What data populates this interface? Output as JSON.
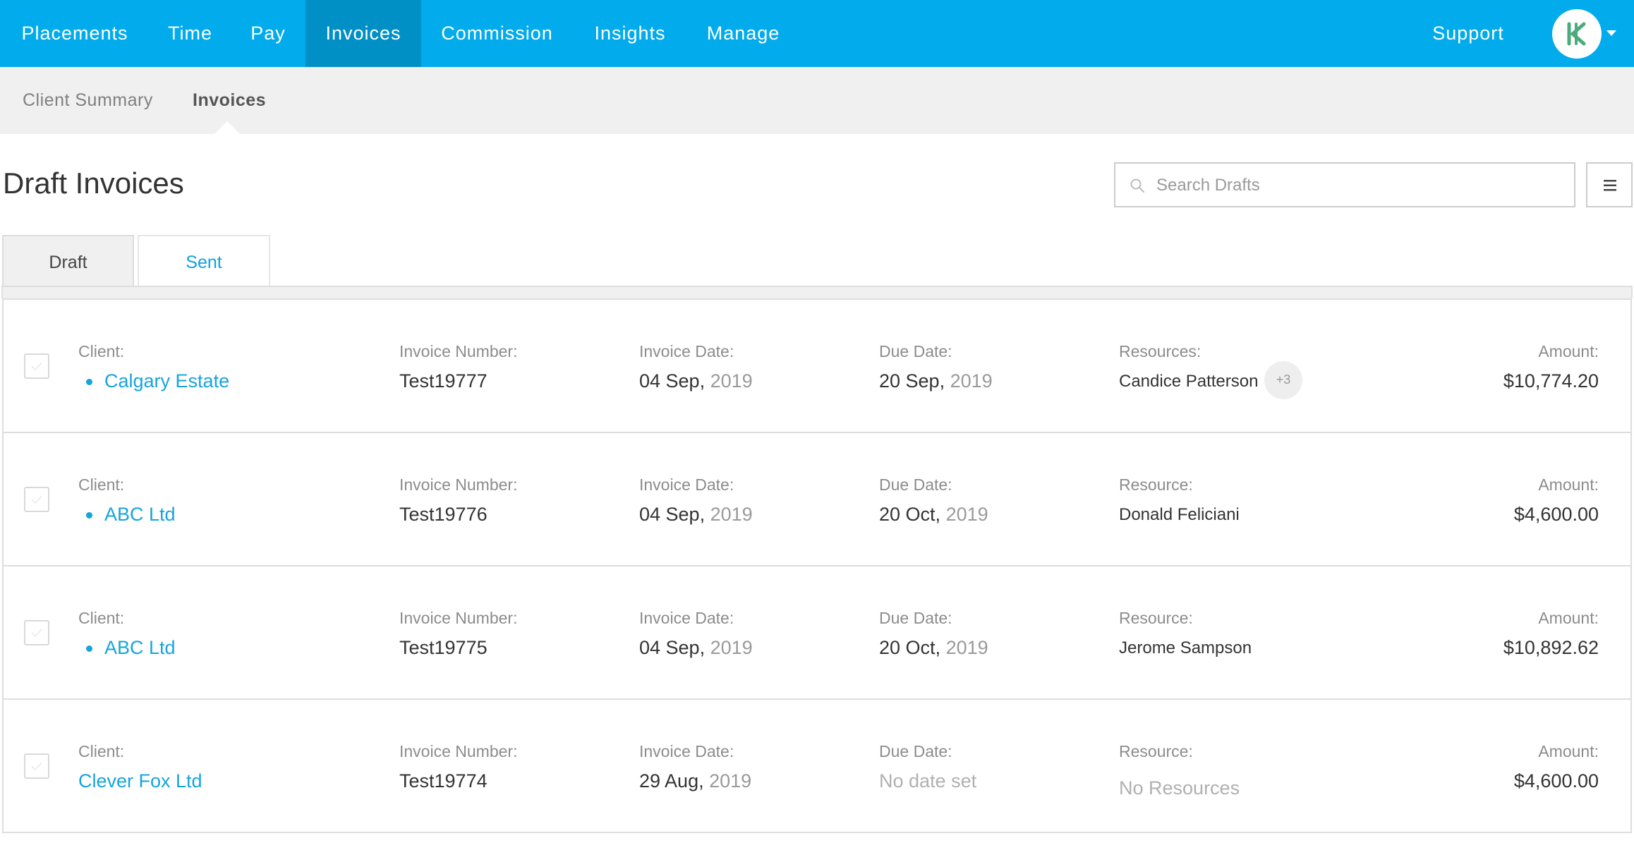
{
  "nav": {
    "items": [
      "Placements",
      "Time",
      "Pay",
      "Invoices",
      "Commission",
      "Insights",
      "Manage"
    ],
    "active": "Invoices",
    "support": "Support",
    "accent_color": "#02abec",
    "active_color": "#0190c6",
    "avatar_icon": "k-logo-icon",
    "avatar_menu_icon": "caret-down-icon"
  },
  "subnav": {
    "items": [
      "Client Summary",
      "Invoices"
    ],
    "active": "Invoices"
  },
  "page": {
    "title": "Draft Invoices"
  },
  "search": {
    "placeholder": "Search Drafts",
    "value": "",
    "icon": "search-icon"
  },
  "menu_button": {
    "icon": "hamburger-menu-icon"
  },
  "tabs": [
    "Draft",
    "Sent"
  ],
  "active_tab": "Draft",
  "labels": {
    "client": "Client:",
    "invoice_number": "Invoice Number:",
    "invoice_date": "Invoice Date:",
    "due_date": "Due Date:",
    "amount": "Amount:"
  },
  "invoices": [
    {
      "client": "Calgary Estate",
      "client_dot": true,
      "invoice_number": "Test19777",
      "invoice_date_day": "04 Sep,",
      "invoice_date_year": "2019",
      "due_date_day": "20 Sep,",
      "due_date_year": "2019",
      "due_date_none": "",
      "resource_label": "Resources:",
      "resource": "Candice Patterson",
      "resource_more": "+3",
      "resource_none": "",
      "amount": "$10,774.20"
    },
    {
      "client": "ABC Ltd",
      "client_dot": true,
      "invoice_number": "Test19776",
      "invoice_date_day": "04 Sep,",
      "invoice_date_year": "2019",
      "due_date_day": "20 Oct,",
      "due_date_year": "2019",
      "due_date_none": "",
      "resource_label": "Resource:",
      "resource": "Donald Feliciani",
      "resource_more": "",
      "resource_none": "",
      "amount": "$4,600.00"
    },
    {
      "client": "ABC Ltd",
      "client_dot": true,
      "invoice_number": "Test19775",
      "invoice_date_day": "04 Sep,",
      "invoice_date_year": "2019",
      "due_date_day": "20 Oct,",
      "due_date_year": "2019",
      "due_date_none": "",
      "resource_label": "Resource:",
      "resource": "Jerome Sampson",
      "resource_more": "",
      "resource_none": "",
      "amount": "$10,892.62"
    },
    {
      "client": "Clever Fox Ltd",
      "client_dot": false,
      "invoice_number": "Test19774",
      "invoice_date_day": "29 Aug,",
      "invoice_date_year": "2019",
      "due_date_day": "",
      "due_date_year": "",
      "due_date_none": "No date set",
      "resource_label": "Resource:",
      "resource": "",
      "resource_more": "",
      "resource_none": "No Resources",
      "amount": "$4,600.00"
    }
  ]
}
